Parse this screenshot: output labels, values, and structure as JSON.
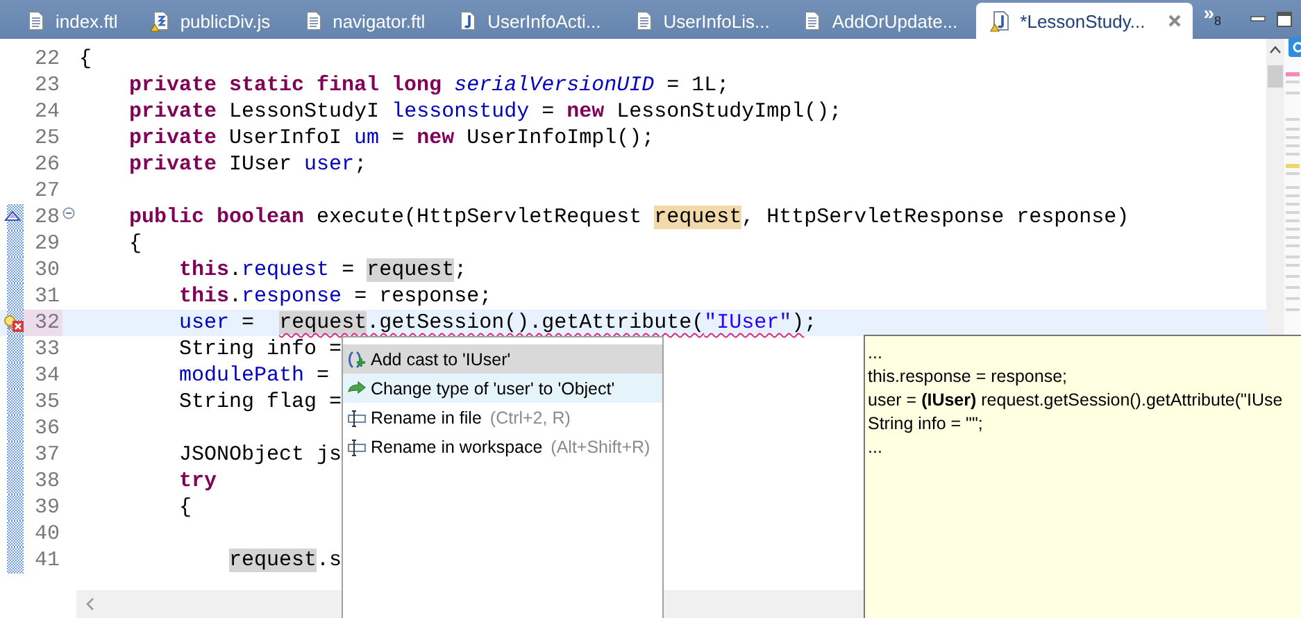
{
  "tabs": [
    {
      "label": "index.ftl",
      "kind": "doc",
      "warning": false,
      "selected": false
    },
    {
      "label": "publicDiv.js",
      "kind": "js",
      "warning": true,
      "selected": false
    },
    {
      "label": "navigator.ftl",
      "kind": "doc",
      "warning": false,
      "selected": false
    },
    {
      "label": "UserInfoActi...",
      "kind": "java",
      "warning": false,
      "selected": false
    },
    {
      "label": "UserInfoLis...",
      "kind": "doc",
      "warning": false,
      "selected": false
    },
    {
      "label": "AddOrUpdate...",
      "kind": "doc",
      "warning": false,
      "selected": false
    },
    {
      "label": "*LessonStudy...",
      "kind": "java",
      "warning": true,
      "selected": true
    }
  ],
  "tab_overflow": {
    "glyph": "»",
    "count": "8"
  },
  "editor": {
    "lines": [
      {
        "number": "22",
        "current": false,
        "changed": false,
        "tokens": [
          {
            "t": "{",
            "kind": "plain"
          }
        ]
      },
      {
        "number": "23",
        "current": false,
        "changed": false,
        "tokens": [
          {
            "t": "    private static final long ",
            "kind": "kw"
          },
          {
            "t": "serialVersionUID",
            "kind": "static"
          },
          {
            "t": " = 1L;",
            "kind": "plain"
          }
        ]
      },
      {
        "number": "24",
        "current": false,
        "changed": false,
        "tokens": [
          {
            "t": "    private ",
            "kind": "kw"
          },
          {
            "t": "LessonStudyI ",
            "kind": "plain"
          },
          {
            "t": "lessonstudy",
            "kind": "field"
          },
          {
            "t": " = ",
            "kind": "plain"
          },
          {
            "t": "new",
            "kind": "kw"
          },
          {
            "t": " LessonStudyImpl();",
            "kind": "plain"
          }
        ]
      },
      {
        "number": "25",
        "current": false,
        "changed": false,
        "tokens": [
          {
            "t": "    private ",
            "kind": "kw"
          },
          {
            "t": "UserInfoI ",
            "kind": "plain"
          },
          {
            "t": "um",
            "kind": "field"
          },
          {
            "t": " = ",
            "kind": "plain"
          },
          {
            "t": "new",
            "kind": "kw"
          },
          {
            "t": " UserInfoImpl();",
            "kind": "plain"
          }
        ]
      },
      {
        "number": "26",
        "current": false,
        "changed": false,
        "tokens": [
          {
            "t": "    private ",
            "kind": "kw"
          },
          {
            "t": "IUser ",
            "kind": "plain"
          },
          {
            "t": "user",
            "kind": "field"
          },
          {
            "t": ";",
            "kind": "plain"
          }
        ]
      },
      {
        "number": "27",
        "current": false,
        "changed": false
      },
      {
        "number": "28",
        "current": false,
        "changed": true,
        "overrides": true,
        "fold": true,
        "tokens": [
          {
            "t": "    public boolean ",
            "kind": "kw"
          },
          {
            "t": "execute(HttpServletRequest ",
            "kind": "plain"
          },
          {
            "t": "request",
            "kind": "plain",
            "write_occurrence": true
          },
          {
            "t": ", HttpServletResponse response)",
            "kind": "plain"
          }
        ]
      },
      {
        "number": "29",
        "current": false,
        "changed": true,
        "tokens": [
          {
            "t": "    {",
            "kind": "plain"
          }
        ]
      },
      {
        "number": "30",
        "current": false,
        "changed": true,
        "tokens": [
          {
            "t": "        this",
            "kind": "kw"
          },
          {
            "t": ".",
            "kind": "plain"
          },
          {
            "t": "request",
            "kind": "field"
          },
          {
            "t": " = ",
            "kind": "plain"
          },
          {
            "t": "request",
            "kind": "plain",
            "read_occurrence": true
          },
          {
            "t": ";",
            "kind": "plain"
          }
        ]
      },
      {
        "number": "31",
        "current": false,
        "changed": true,
        "tokens": [
          {
            "t": "        this",
            "kind": "kw"
          },
          {
            "t": ".",
            "kind": "plain"
          },
          {
            "t": "response",
            "kind": "field"
          },
          {
            "t": " = response;",
            "kind": "plain"
          }
        ]
      },
      {
        "number": "32",
        "current": true,
        "changed": true,
        "error": true,
        "tokens": [
          {
            "t": "        user",
            "kind": "field"
          },
          {
            "t": " =  ",
            "kind": "plain"
          },
          {
            "t": "request",
            "kind": "plain",
            "read_occurrence": true,
            "squiggle": true
          },
          {
            "t": ".getSession().getAttribute(",
            "kind": "plain",
            "squiggle": true
          },
          {
            "t": "\"IUser\"",
            "kind": "str",
            "squiggle": true
          },
          {
            "t": ")",
            "kind": "plain",
            "squiggle": true
          },
          {
            "t": ";",
            "kind": "plain"
          }
        ]
      },
      {
        "number": "33",
        "current": false,
        "changed": true,
        "tokens": [
          {
            "t": "        String info =",
            "kind": "plain"
          }
        ]
      },
      {
        "number": "34",
        "current": false,
        "changed": true,
        "tokens": [
          {
            "t": "        modulePath",
            "kind": "field"
          },
          {
            "t": " =",
            "kind": "plain"
          }
        ]
      },
      {
        "number": "35",
        "current": false,
        "changed": true,
        "tokens": [
          {
            "t": "        String flag =",
            "kind": "plain"
          }
        ]
      },
      {
        "number": "36",
        "current": false,
        "changed": true
      },
      {
        "number": "37",
        "current": false,
        "changed": true,
        "tokens": [
          {
            "t": "        JSONObject js",
            "kind": "plain"
          }
        ]
      },
      {
        "number": "38",
        "current": false,
        "changed": true,
        "tokens": [
          {
            "t": "        try",
            "kind": "kw"
          }
        ]
      },
      {
        "number": "39",
        "current": false,
        "changed": true,
        "tokens": [
          {
            "t": "        {",
            "kind": "plain"
          }
        ]
      },
      {
        "number": "40",
        "current": false,
        "changed": true
      },
      {
        "number": "41",
        "current": false,
        "changed": true,
        "tokens": [
          {
            "t": "            request",
            "kind": "plain",
            "read_occurrence": true
          },
          {
            "t": ".s",
            "kind": "plain"
          }
        ]
      }
    ]
  },
  "quick_fix": {
    "items": [
      {
        "kind": "cast",
        "label": "Add cast to 'IUser'",
        "selected": true,
        "hovered": false
      },
      {
        "kind": "change",
        "label": "Change type of 'user' to 'Object'",
        "selected": false,
        "hovered": true
      },
      {
        "kind": "rename",
        "label": "Rename in file",
        "shortcut": "(Ctrl+2, R)",
        "selected": false,
        "hovered": false
      },
      {
        "kind": "rename",
        "label": "Rename in workspace",
        "shortcut": "(Alt+Shift+R)",
        "selected": false,
        "hovered": false
      }
    ],
    "preview": [
      "...",
      "this.response = response;",
      "user = **(IUser)** request.getSession().getAttribute(\"IUse",
      "String info = \"\";",
      "..."
    ]
  }
}
